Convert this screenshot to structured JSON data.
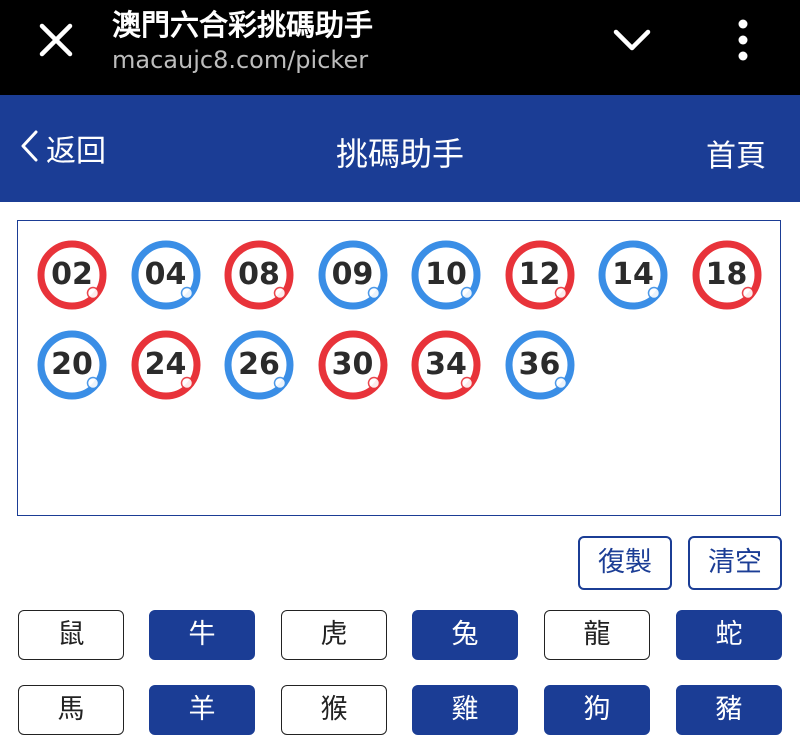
{
  "browser": {
    "title": "澳門六合彩挑碼助手",
    "url": "macaujc8.com/picker"
  },
  "appbar": {
    "back_label": "返回",
    "title": "挑碼助手",
    "home_label": "首頁"
  },
  "balls": [
    {
      "num": "02",
      "color": "#e8333a"
    },
    {
      "num": "04",
      "color": "#3a8ee6"
    },
    {
      "num": "08",
      "color": "#e8333a"
    },
    {
      "num": "09",
      "color": "#3a8ee6"
    },
    {
      "num": "10",
      "color": "#3a8ee6"
    },
    {
      "num": "12",
      "color": "#e8333a"
    },
    {
      "num": "14",
      "color": "#3a8ee6"
    },
    {
      "num": "18",
      "color": "#e8333a"
    },
    {
      "num": "20",
      "color": "#3a8ee6"
    },
    {
      "num": "24",
      "color": "#e8333a"
    },
    {
      "num": "26",
      "color": "#3a8ee6"
    },
    {
      "num": "30",
      "color": "#e8333a"
    },
    {
      "num": "34",
      "color": "#e8333a"
    },
    {
      "num": "36",
      "color": "#3a8ee6"
    }
  ],
  "actions": {
    "copy_label": "復製",
    "clear_label": "清空"
  },
  "zodiac": [
    {
      "label": "鼠",
      "selected": false
    },
    {
      "label": "牛",
      "selected": true
    },
    {
      "label": "虎",
      "selected": false
    },
    {
      "label": "兔",
      "selected": true
    },
    {
      "label": "龍",
      "selected": false
    },
    {
      "label": "蛇",
      "selected": true
    },
    {
      "label": "馬",
      "selected": false
    },
    {
      "label": "羊",
      "selected": true
    },
    {
      "label": "猴",
      "selected": false
    },
    {
      "label": "雞",
      "selected": true
    },
    {
      "label": "狗",
      "selected": true
    },
    {
      "label": "豬",
      "selected": true
    }
  ],
  "colors": {
    "brand": "#1b3d95",
    "red_ball": "#e8333a",
    "blue_ball": "#3a8ee6"
  }
}
